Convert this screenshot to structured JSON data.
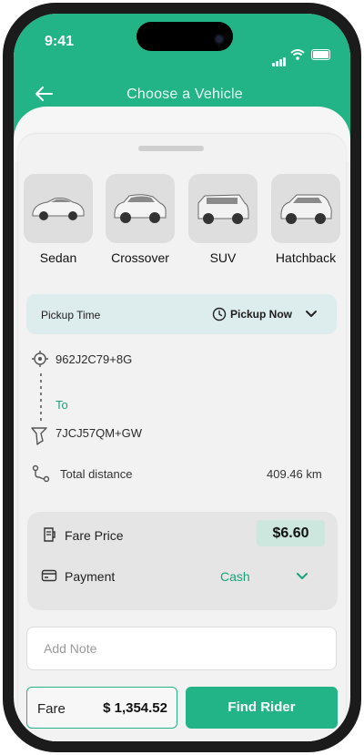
{
  "status_bar": {
    "time": "9:41"
  },
  "header": {
    "title": "Choose a Vehicle",
    "back_icon": "arrow-left-icon"
  },
  "vehicles": [
    {
      "label": "Sedan"
    },
    {
      "label": "Crossover"
    },
    {
      "label": "SUV"
    },
    {
      "label": "Hatchback"
    }
  ],
  "pickup": {
    "label": "Pickup Time",
    "value": "Pickup Now"
  },
  "route": {
    "origin": "962J2C79+8G",
    "to_label": "To",
    "destination": "7JCJ57QM+GW",
    "distance_label": "Total distance",
    "distance_value": "409.46 km"
  },
  "fare": {
    "price_label": "Fare Price",
    "price_value": "$6.60",
    "payment_label": "Payment",
    "payment_value": "Cash"
  },
  "note": {
    "placeholder": "Add Note"
  },
  "footer": {
    "fare_label": "Fare",
    "fare_value": "$ 1,354.52",
    "find_rider_label": "Find Rider"
  },
  "colors": {
    "primary": "#22b386",
    "accent_text": "#1aa37a",
    "pickup_bg": "#ddeced"
  }
}
